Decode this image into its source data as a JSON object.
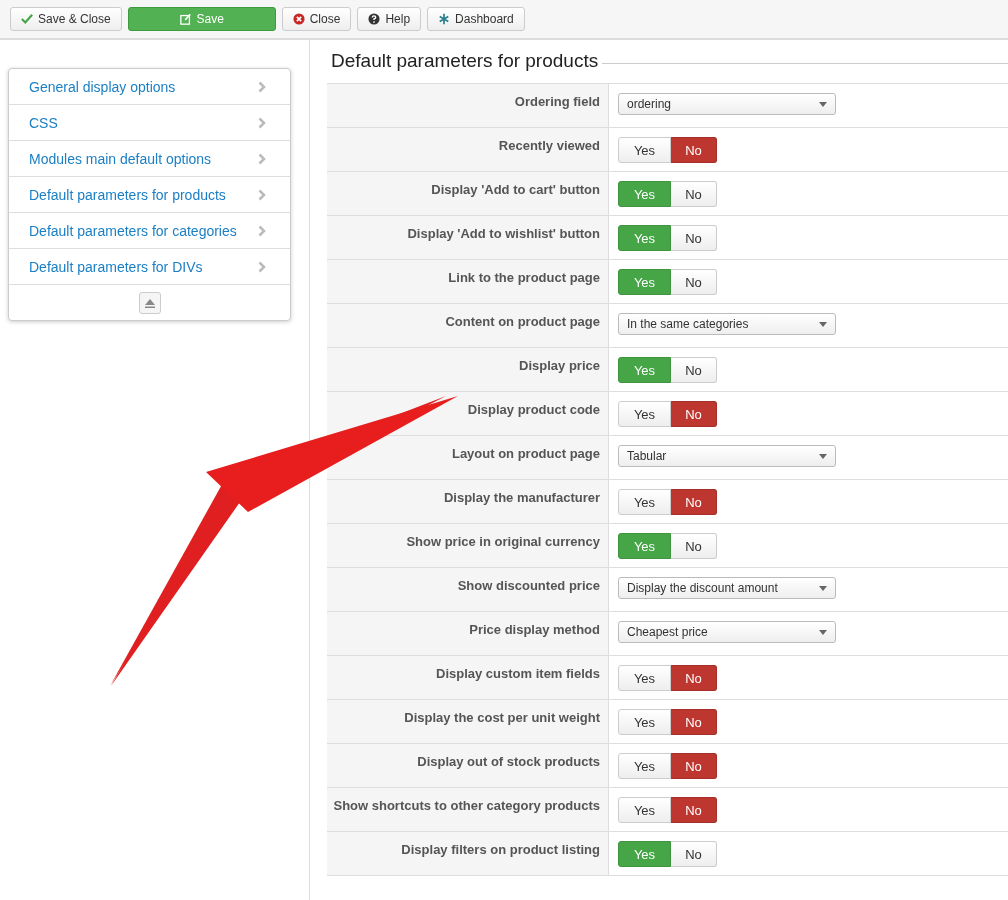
{
  "toolbar": [
    {
      "label": "Save & Close",
      "kind": "check"
    },
    {
      "label": "Save",
      "kind": "save"
    },
    {
      "label": "Close",
      "kind": "close"
    },
    {
      "label": "Help",
      "kind": "help"
    },
    {
      "label": "Dashboard",
      "kind": "dashboard"
    }
  ],
  "sidebar": {
    "items": [
      {
        "label": "General display options"
      },
      {
        "label": "CSS"
      },
      {
        "label": "Modules main default options"
      },
      {
        "label": "Default parameters for products"
      },
      {
        "label": "Default parameters for categories"
      },
      {
        "label": "Default parameters for DIVs"
      }
    ]
  },
  "section": {
    "title": "Default parameters for products"
  },
  "rows": [
    {
      "label": "Ordering field",
      "kind": "select",
      "value": "ordering"
    },
    {
      "label": "Recently viewed",
      "kind": "toggle",
      "options": [
        {
          "label": "Yes",
          "selected": false
        },
        {
          "label": "No",
          "selected": true
        }
      ]
    },
    {
      "label": "Display 'Add to cart' button",
      "kind": "toggle",
      "options": [
        {
          "label": "Yes",
          "selected": true
        },
        {
          "label": "No",
          "selected": false
        }
      ]
    },
    {
      "label": "Display 'Add to wishlist' button",
      "kind": "toggle",
      "options": [
        {
          "label": "Yes",
          "selected": true
        },
        {
          "label": "No",
          "selected": false
        }
      ]
    },
    {
      "label": "Link to the product page",
      "kind": "toggle",
      "options": [
        {
          "label": "Yes",
          "selected": true
        },
        {
          "label": "No",
          "selected": false
        }
      ]
    },
    {
      "label": "Content on product page",
      "kind": "select",
      "value": "In the same categories"
    },
    {
      "label": "Display price",
      "kind": "toggle",
      "options": [
        {
          "label": "Yes",
          "selected": true
        },
        {
          "label": "No",
          "selected": false
        }
      ]
    },
    {
      "label": "Display product code",
      "kind": "toggle",
      "options": [
        {
          "label": "Yes",
          "selected": false
        },
        {
          "label": "No",
          "selected": true
        }
      ]
    },
    {
      "label": "Layout on product page",
      "kind": "select",
      "value": "Tabular"
    },
    {
      "label": "Display the manufacturer",
      "kind": "toggle",
      "options": [
        {
          "label": "Yes",
          "selected": false
        },
        {
          "label": "No",
          "selected": true
        }
      ]
    },
    {
      "label": "Show price in original currency",
      "kind": "toggle",
      "options": [
        {
          "label": "Yes",
          "selected": true
        },
        {
          "label": "No",
          "selected": false
        }
      ]
    },
    {
      "label": "Show discounted price",
      "kind": "select",
      "value": "Display the discount amount"
    },
    {
      "label": "Price display method",
      "kind": "select",
      "value": "Cheapest price"
    },
    {
      "label": "Display custom item fields",
      "kind": "toggle",
      "options": [
        {
          "label": "Yes",
          "selected": false
        },
        {
          "label": "No",
          "selected": true
        }
      ]
    },
    {
      "label": "Display the cost per unit weight",
      "kind": "toggle",
      "options": [
        {
          "label": "Yes",
          "selected": false
        },
        {
          "label": "No",
          "selected": true
        }
      ]
    },
    {
      "label": "Display out of stock products",
      "kind": "toggle",
      "options": [
        {
          "label": "Yes",
          "selected": false
        },
        {
          "label": "No",
          "selected": true
        }
      ]
    },
    {
      "label": "Show shortcuts to other category products",
      "kind": "toggle",
      "options": [
        {
          "label": "Yes",
          "selected": false
        },
        {
          "label": "No",
          "selected": true
        }
      ]
    },
    {
      "label": "Display filters on product listing",
      "kind": "toggle",
      "options": [
        {
          "label": "Yes",
          "selected": true
        },
        {
          "label": "No",
          "selected": false
        }
      ]
    }
  ]
}
